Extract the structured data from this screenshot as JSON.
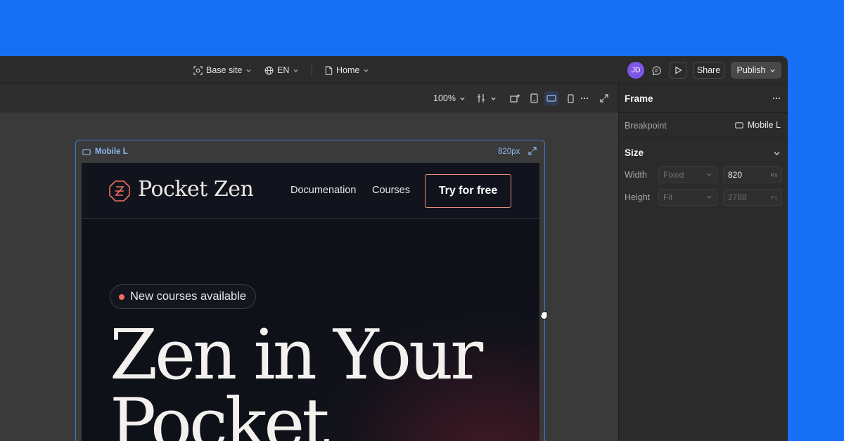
{
  "topbar": {
    "site_selector": "Base site",
    "language": "EN",
    "page": "Home",
    "avatar_initials": "JD",
    "share": "Share",
    "publish": "Publish"
  },
  "canvas_toolbar": {
    "zoom": "100%"
  },
  "panel": {
    "title": "Frame",
    "breakpoint_label": "Breakpoint",
    "breakpoint_value": "Mobile L",
    "size_title": "Size",
    "width_label": "Width",
    "width_mode": "Fixed",
    "width_value": "820",
    "width_unit": "PX",
    "height_label": "Height",
    "height_mode": "Fit",
    "height_value": "2788",
    "height_unit": "PX"
  },
  "frame": {
    "name": "Mobile L",
    "width_readout": "820px"
  },
  "site": {
    "logo": "Pocket Zen",
    "nav_links": [
      "Documenation",
      "Courses"
    ],
    "cta": "Try for free",
    "badge": "New courses available",
    "hero_lines": [
      "Zen in Your",
      "Pocket"
    ]
  },
  "colors": {
    "background": "#1570f5",
    "accent": "#ef6f5f",
    "selection": "#3a78d0",
    "avatar": "#7e57e8"
  }
}
